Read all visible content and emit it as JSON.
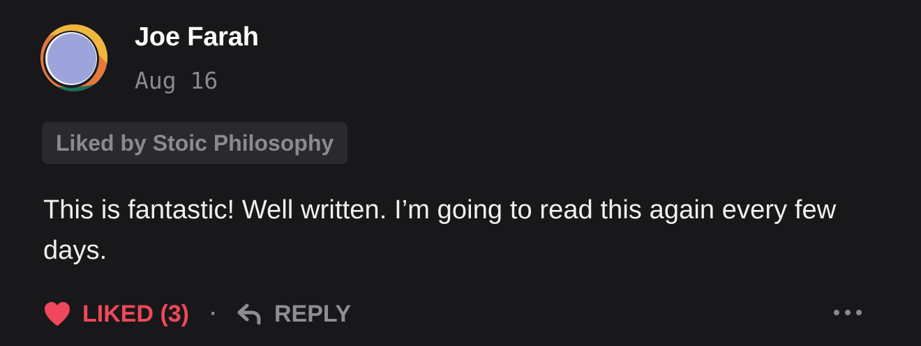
{
  "comment": {
    "author": "Joe Farah",
    "date": "Aug 16",
    "liked_by": "Liked by Stoic Philosophy",
    "body": "This is fantastic! Well written. I’m going to read this again every few days."
  },
  "actions": {
    "like_label": "LIKED (3)",
    "separator": "·",
    "reply_label": "REPLY"
  },
  "icons": {
    "like": "heart-icon",
    "reply": "reply-arrow-icon",
    "more": "more-dots-icon"
  },
  "colors": {
    "background": "#18181a",
    "liked_accent": "#f0485a",
    "muted_text": "#8a8a8e",
    "badge_background": "#2a2a2c"
  }
}
